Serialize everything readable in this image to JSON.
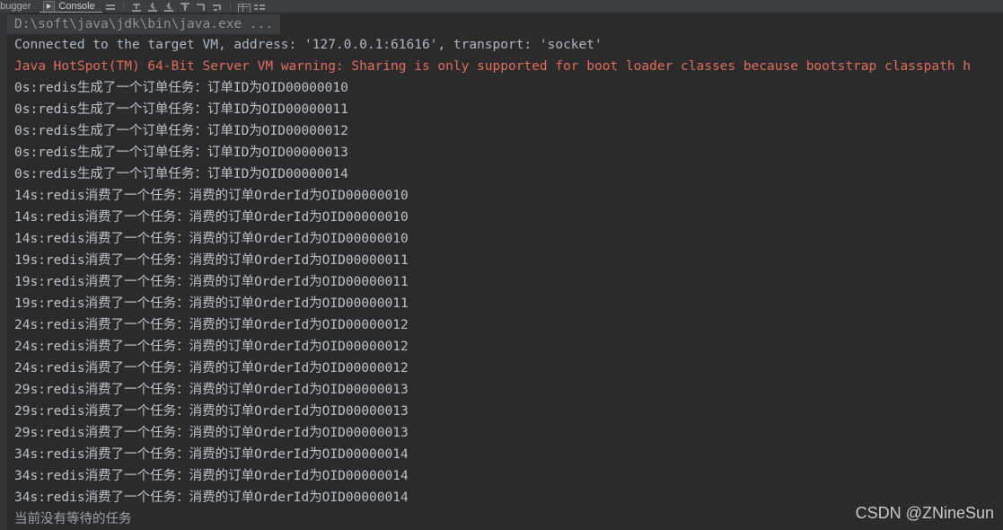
{
  "toolbar": {
    "tabs": [
      {
        "label": "ebugger",
        "icon": "bug-icon",
        "active": false
      },
      {
        "label": "Console",
        "icon": "run-icon",
        "active": true
      }
    ],
    "buttons": [
      {
        "name": "show-execution-point-icon",
        "label": ""
      },
      {
        "name": "step-over-icon",
        "label": ""
      },
      {
        "name": "step-into-icon",
        "label": ""
      },
      {
        "name": "force-step-into-icon",
        "label": ""
      },
      {
        "name": "step-out-icon",
        "label": ""
      },
      {
        "name": "drop-frame-icon",
        "label": ""
      },
      {
        "name": "run-to-cursor-icon",
        "label": ""
      },
      {
        "name": "evaluate-expression-icon",
        "label": ""
      },
      {
        "name": "settings-list-icon",
        "label": ""
      }
    ]
  },
  "console": {
    "command_line": "D:\\soft\\java\\jdk\\bin\\java.exe ...",
    "lines": [
      {
        "cls": "info",
        "text": "Connected to the target VM, address: '127.0.0.1:61616', transport: 'socket'"
      },
      {
        "cls": "warn",
        "text": "Java HotSpot(TM) 64-Bit Server VM warning: Sharing is only supported for boot loader classes because bootstrap classpath h"
      },
      {
        "cls": "log",
        "text": "0s:redis生成了一个订单任务：订单ID为OID00000010"
      },
      {
        "cls": "log",
        "text": "0s:redis生成了一个订单任务：订单ID为OID00000011"
      },
      {
        "cls": "log",
        "text": "0s:redis生成了一个订单任务：订单ID为OID00000012"
      },
      {
        "cls": "log",
        "text": "0s:redis生成了一个订单任务：订单ID为OID00000013"
      },
      {
        "cls": "log",
        "text": "0s:redis生成了一个订单任务：订单ID为OID00000014"
      },
      {
        "cls": "log",
        "text": "14s:redis消费了一个任务：消费的订单OrderId为OID00000010"
      },
      {
        "cls": "log",
        "text": "14s:redis消费了一个任务：消费的订单OrderId为OID00000010"
      },
      {
        "cls": "log",
        "text": "14s:redis消费了一个任务：消费的订单OrderId为OID00000010"
      },
      {
        "cls": "log",
        "text": "19s:redis消费了一个任务：消费的订单OrderId为OID00000011"
      },
      {
        "cls": "log",
        "text": "19s:redis消费了一个任务：消费的订单OrderId为OID00000011"
      },
      {
        "cls": "log",
        "text": "19s:redis消费了一个任务：消费的订单OrderId为OID00000011"
      },
      {
        "cls": "log",
        "text": "24s:redis消费了一个任务：消费的订单OrderId为OID00000012"
      },
      {
        "cls": "log",
        "text": "24s:redis消费了一个任务：消费的订单OrderId为OID00000012"
      },
      {
        "cls": "log",
        "text": "24s:redis消费了一个任务：消费的订单OrderId为OID00000012"
      },
      {
        "cls": "log",
        "text": "29s:redis消费了一个任务：消费的订单OrderId为OID00000013"
      },
      {
        "cls": "log",
        "text": "29s:redis消费了一个任务：消费的订单OrderId为OID00000013"
      },
      {
        "cls": "log",
        "text": "29s:redis消费了一个任务：消费的订单OrderId为OID00000013"
      },
      {
        "cls": "log",
        "text": "34s:redis消费了一个任务：消费的订单OrderId为OID00000014"
      },
      {
        "cls": "log",
        "text": "34s:redis消费了一个任务：消费的订单OrderId为OID00000014"
      },
      {
        "cls": "log",
        "text": "34s:redis消费了一个任务：消费的订单OrderId为OID00000014"
      },
      {
        "cls": "tail",
        "text": "当前没有等待的任务"
      }
    ]
  },
  "watermark": "CSDN @ZNineSun",
  "colors": {
    "background": "#2b2b2b",
    "toolbar": "#3c3f41",
    "text": "#a9b7c6",
    "warning": "#e06c5e",
    "gutter": "#313335"
  }
}
